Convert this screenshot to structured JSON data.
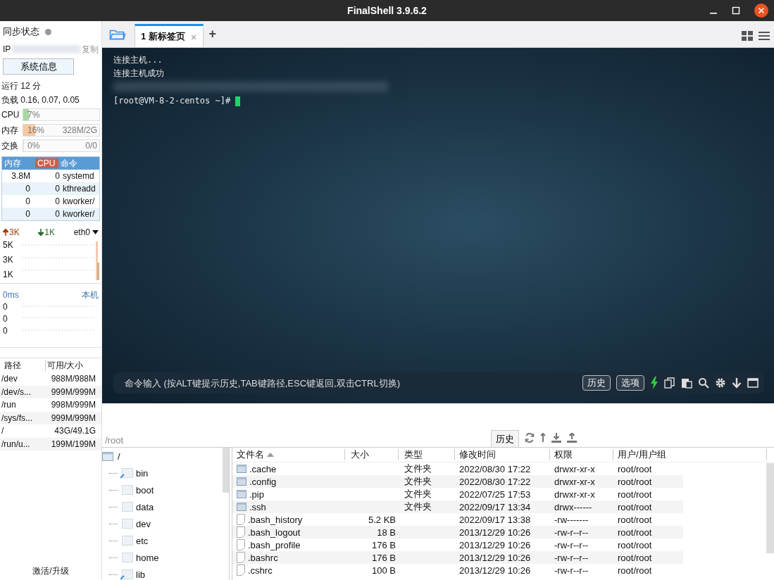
{
  "window": {
    "title": "FinalShell 3.9.6.2"
  },
  "sidebar": {
    "sync_label": "同步状态",
    "ip_label": "IP",
    "copy_link": "复制",
    "sysinfo_button": "系统信息",
    "uptime": "运行 12 分",
    "load": "负载 0.16, 0.07, 0.05",
    "meters": [
      {
        "label": "CPU",
        "level": 0.07,
        "reading": "7%",
        "color": "#a8d8a0"
      },
      {
        "label": "内存",
        "level": 0.16,
        "reading": "16%",
        "detail": "328M/2G",
        "color": "#f5c8a0"
      },
      {
        "label": "交换",
        "level": 0,
        "reading": "0%",
        "detail": "0/0"
      }
    ],
    "process_columns": [
      {
        "label": "内存",
        "selected": false
      },
      {
        "label": "CPU",
        "selected": true
      },
      {
        "label": "命令",
        "selected": false
      }
    ],
    "processes": [
      {
        "mem": "3.8M",
        "cpu": "0",
        "cmd": "systemd"
      },
      {
        "mem": "0",
        "cpu": "0",
        "cmd": "kthreadd"
      },
      {
        "mem": "0",
        "cpu": "0",
        "cmd": "kworker/"
      },
      {
        "mem": "0",
        "cpu": "0",
        "cmd": "kworker/"
      }
    ],
    "network": {
      "up": "3K",
      "down": "1K",
      "interface": "eth0",
      "y_labels": [
        "5K",
        "3K",
        "1K"
      ]
    },
    "ping": {
      "latency": "0ms",
      "target": "本机",
      "y_labels": [
        "0",
        "0",
        "0"
      ]
    },
    "disk_columns": [
      "路径",
      "可用/大小"
    ],
    "disks": [
      {
        "path": "/dev",
        "usage": "988M/988M"
      },
      {
        "path": "/dev/s...",
        "usage": "999M/999M"
      },
      {
        "path": "/run",
        "usage": "998M/999M"
      },
      {
        "path": "/sys/fs...",
        "usage": "999M/999M"
      },
      {
        "path": "/",
        "usage": "43G/49.1G"
      },
      {
        "path": "/run/u...",
        "usage": "199M/199M"
      }
    ],
    "upgrade_link": "激活/升级"
  },
  "tabs": [
    {
      "label": "1 新标签页",
      "selected": true,
      "close": "×"
    }
  ],
  "new_tab": "+",
  "terminal": {
    "lines": [
      "连接主机...",
      "连接主机成功"
    ],
    "prompt": "[root@VM-8-2-centos ~]#"
  },
  "command_bar": {
    "placeholder": "命令输入 (按ALT键提示历史,TAB键路径,ESC键返回,双击CTRL切换)",
    "buttons": [
      "历史",
      "选项"
    ]
  },
  "file_browser": {
    "path": "/root",
    "history_button": "历史",
    "tree": {
      "label": "/",
      "children": [
        {
          "label": "bin",
          "kind": "link"
        },
        {
          "label": "boot",
          "kind": "folder"
        },
        {
          "label": "data",
          "kind": "folder"
        },
        {
          "label": "dev",
          "kind": "folder"
        },
        {
          "label": "etc",
          "kind": "folder"
        },
        {
          "label": "home",
          "kind": "folder"
        },
        {
          "label": "lib",
          "kind": "link"
        }
      ]
    },
    "columns": [
      "文件名",
      "大小",
      "类型",
      "修改时间",
      "权限",
      "用户/用户组"
    ],
    "rows": [
      {
        "kind": "folder",
        "name": ".cache",
        "size": "",
        "type": "文件夹",
        "modified": "2022/08/30 17:22",
        "perms": "drwxr-xr-x",
        "owner": "root/root"
      },
      {
        "kind": "folder",
        "name": ".config",
        "size": "",
        "type": "文件夹",
        "modified": "2022/08/30 17:22",
        "perms": "drwxr-xr-x",
        "owner": "root/root"
      },
      {
        "kind": "folder",
        "name": ".pip",
        "size": "",
        "type": "文件夹",
        "modified": "2022/07/25 17:53",
        "perms": "drwxr-xr-x",
        "owner": "root/root"
      },
      {
        "kind": "folder",
        "name": ".ssh",
        "size": "",
        "type": "文件夹",
        "modified": "2022/09/17 13:34",
        "perms": "drwx------",
        "owner": "root/root"
      },
      {
        "kind": "file",
        "name": ".bash_history",
        "size": "5.2 KB",
        "type": "",
        "modified": "2022/09/17 13:38",
        "perms": "-rw-------",
        "owner": "root/root"
      },
      {
        "kind": "file",
        "name": ".bash_logout",
        "size": "18 B",
        "type": "",
        "modified": "2013/12/29 10:26",
        "perms": "-rw-r--r--",
        "owner": "root/root"
      },
      {
        "kind": "file",
        "name": ".bash_profile",
        "size": "176 B",
        "type": "",
        "modified": "2013/12/29 10:26",
        "perms": "-rw-r--r--",
        "owner": "root/root"
      },
      {
        "kind": "file",
        "name": ".bashrc",
        "size": "176 B",
        "type": "",
        "modified": "2013/12/29 10:26",
        "perms": "-rw-r--r--",
        "owner": "root/root"
      },
      {
        "kind": "file",
        "name": ".cshrc",
        "size": "100 B",
        "type": "",
        "modified": "2013/12/29 10:26",
        "perms": "-rw-r--r--",
        "owner": "root/root"
      }
    ]
  }
}
